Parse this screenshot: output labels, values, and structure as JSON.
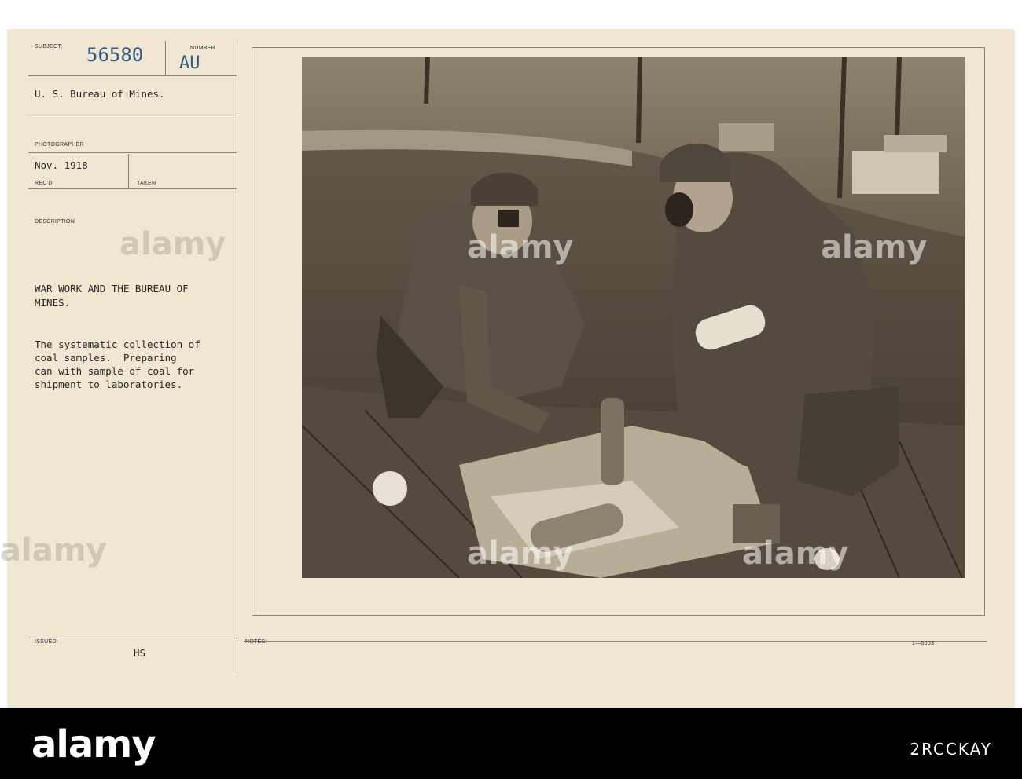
{
  "card": {
    "subject_label": "SUBJECT:",
    "subject_number": "56580",
    "number_label": "NUMBER",
    "number_value": "AU",
    "agency": "U. S. Bureau of Mines.",
    "photographer_label": "PHOTOGRAPHER",
    "date": "Nov. 1918",
    "recd_label": "REC'D",
    "taken_label": "TAKEN",
    "description_label": "DESCRIPTION",
    "title_line1": "WAR WORK AND THE BUREAU OF",
    "title_line2": "MINES.",
    "desc_line1": "The systematic collection of",
    "desc_line2": "coal samples.  Preparing",
    "desc_line3": "can with sample of coal for",
    "desc_line4": "shipment to laboratories.",
    "issued_label": "ISSUED:",
    "issued_value": "HS",
    "notes_label": "NOTES:",
    "form_code": "1—5003"
  },
  "watermark": {
    "text": "alamy",
    "image_id": "2RCCKAY"
  },
  "colors": {
    "card": "#f1e6d2",
    "stamp": "#2f5d86",
    "photo_sepia": "#8a7b66"
  }
}
